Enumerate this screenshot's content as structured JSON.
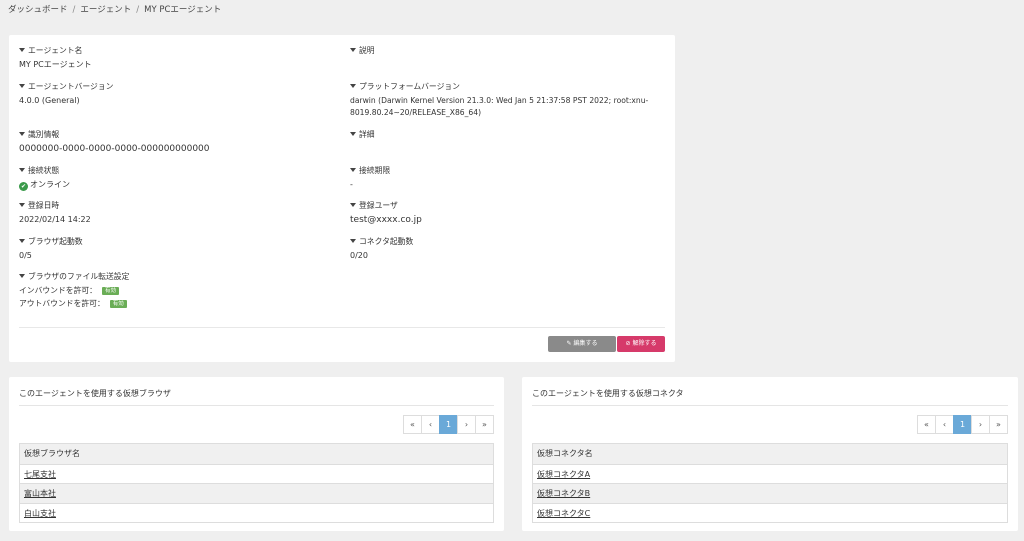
{
  "breadcrumb": {
    "items": [
      "ダッシュボード",
      "エージェント",
      "MY PCエージェント"
    ],
    "separator": "/"
  },
  "agent": {
    "name_label": "エージェント名",
    "name": "MY PCエージェント",
    "desc_label": "説明",
    "desc": "",
    "version_label": "エージェントバージョン",
    "version": "4.0.0 (General)",
    "platform_label": "プラットフォームバージョン",
    "platform_line1": "darwin (Darwin Kernel Version 21.3.0: Wed Jan 5 21:37:58 PST 2022; root:xnu-",
    "platform_line2": "8019.80.24~20/RELEASE_X86_64)",
    "id_label": "識別情報",
    "id": "0000000-0000-0000-0000-000000000000",
    "detail_label": "詳細",
    "detail": "",
    "status_label": "接続状態",
    "status": "オンライン",
    "expiry_label": "接続期限",
    "expiry": "-",
    "registered_label": "登録日時",
    "registered": "2022/02/14 14:22",
    "user_label": "登録ユーザ",
    "user": "test@xxxx.co.jp",
    "browsers_label": "ブラウザ起動数",
    "browsers": "0/5",
    "connectors_label": "コネクタ起動数",
    "connectors": "0/20",
    "transfer_label": "ブラウザのファイル転送設定",
    "inbound_label": "インバウンドを許可：",
    "inbound_badge": "有効",
    "outbound_label": "アウトバウンドを許可：",
    "outbound_badge": "有効"
  },
  "actions": {
    "edit": "編集する",
    "release": "解除する"
  },
  "browser_panel": {
    "title": "このエージェントを使用する仮想ブラウザ",
    "column": "仮想ブラウザ名",
    "rows": [
      "七尾支社",
      "富山本社",
      "白山支社"
    ]
  },
  "connector_panel": {
    "title": "このエージェントを使用する仮想コネクタ",
    "column": "仮想コネクタ名",
    "rows": [
      "仮想コネクタA",
      "仮想コネクタB",
      "仮想コネクタC"
    ]
  },
  "pagination": {
    "first": "«",
    "prev": "‹",
    "current": "1",
    "next": "›",
    "last": "»"
  },
  "colors": {
    "badge": "#6aad56",
    "release": "#d63a6a",
    "page_active": "#6aa9d8",
    "online": "#3a9a4a"
  }
}
